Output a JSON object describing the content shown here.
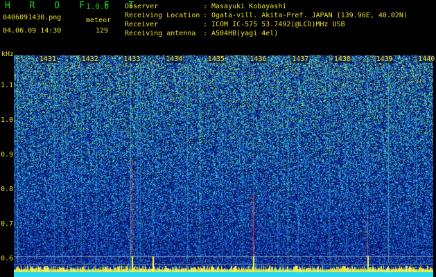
{
  "header": {
    "title": "H R O F F T",
    "version": "1.0.0",
    "filename": "0406091430.png",
    "mode": "meteor",
    "timestamp": "04.06.09 14:30",
    "count": "129"
  },
  "station": {
    "observer_label": "Observer",
    "observer": "Masayuki Kobayashi",
    "location_label": "Receiving Location",
    "location": "Ogata-vill. Akita-Pref. JAPAN (139.96E, 40.02N)",
    "receiver_label": "Receiver",
    "receiver": "ICOM IC-575 53.7492(@LCD)MHz USB",
    "antenna_label": "Receiving antenna",
    "antenna": "A504HB(yagi 4el)",
    "separator": ":"
  },
  "axes": {
    "y_unit": "kHz",
    "y_ticks": [
      "1.1",
      "1.0",
      "0.9",
      "0.8",
      "0.7",
      "0.6"
    ],
    "x_ticks": [
      "1431",
      "1432",
      "1433",
      "1434",
      "1435",
      "1436",
      "1437",
      "1438",
      "1439",
      "1440"
    ]
  },
  "colors": {
    "background": "#000000",
    "text": "#e8e030",
    "title": "#1fd11f",
    "noise_low": "#0a1f8c",
    "noise_high": "#1fd11f",
    "baseline": "#2ad8f0",
    "meteor_trail": "#ff3344"
  }
}
